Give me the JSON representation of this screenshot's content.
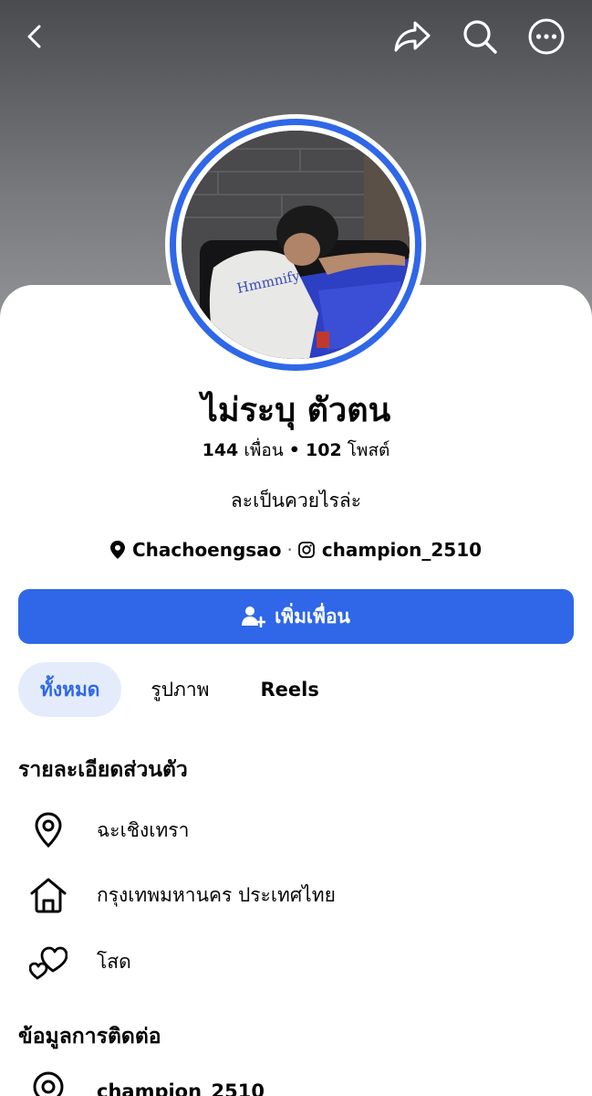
{
  "header": {
    "back_icon": "chevron-left-icon",
    "share_icon": "share-icon",
    "search_icon": "search-icon",
    "more_icon": "more-horizontal-icon"
  },
  "profile": {
    "name": "ไม่ระบุ ตัวตน",
    "friends_count": "144",
    "friends_label": "เพื่อน",
    "separator": "•",
    "posts_count": "102",
    "posts_label": "โพสต์",
    "bio": "ละเป็นควยไรล่ะ",
    "location": "Chachoengsao",
    "meta_separator": "·",
    "instagram": "champion_2510",
    "ring_color": "#2f67e8"
  },
  "actions": {
    "add_friend_label": "เพิ่มเพื่อน",
    "accent": "#2f67e8"
  },
  "tabs": [
    {
      "label": "ทั้งหมด",
      "active": true
    },
    {
      "label": "รูปภาพ",
      "active": false
    },
    {
      "label": "Reels",
      "active": false
    }
  ],
  "details": {
    "title": "รายละเอียดส่วนตัว",
    "items": [
      {
        "icon": "location-pin-icon",
        "label": "ฉะเชิงเทรา"
      },
      {
        "icon": "home-icon",
        "label": "กรุงเทพมหานคร ประเทศไทย"
      },
      {
        "icon": "hearts-icon",
        "label": "โสด"
      }
    ]
  },
  "contact": {
    "title": "ข้อมูลการติดต่อ",
    "instagram": "champion_2510"
  }
}
